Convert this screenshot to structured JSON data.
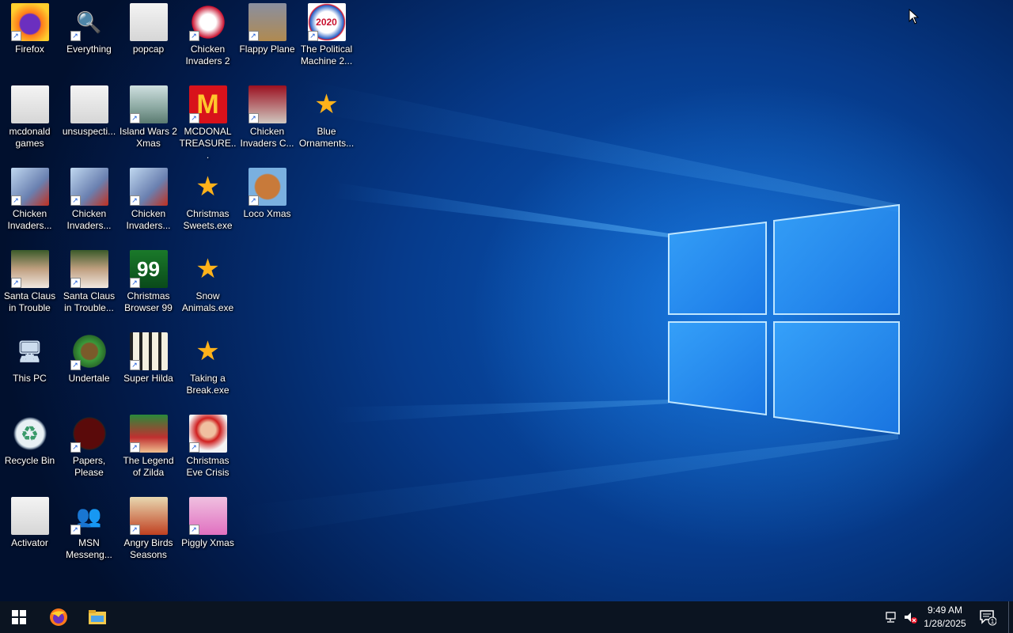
{
  "desktop_icons": [
    {
      "label": "Firefox",
      "icon": "firefox-icon",
      "shortcut": true
    },
    {
      "label": "Everything",
      "icon": "everything-search-icon",
      "shortcut": true
    },
    {
      "label": "popcap",
      "icon": "folder-icon",
      "shortcut": false
    },
    {
      "label": "Chicken Invaders 2",
      "icon": "chicken-invaders-2-icon",
      "shortcut": true
    },
    {
      "label": "Flappy Plane",
      "icon": "flappy-plane-icon",
      "shortcut": true
    },
    {
      "label": "The Political Machine 2...",
      "icon": "political-machine-2020-icon",
      "shortcut": true
    },
    {
      "label": "mcdonald games",
      "icon": "folder-icon",
      "shortcut": false
    },
    {
      "label": "unsuspecti...",
      "icon": "folder-icon",
      "shortcut": false
    },
    {
      "label": "Island Wars 2 Xmas",
      "icon": "island-wars-icon",
      "shortcut": true
    },
    {
      "label": "MCDONAL TREASURE...",
      "icon": "mcdonalds-icon",
      "shortcut": true
    },
    {
      "label": "Chicken Invaders C...",
      "icon": "chicken-invaders-christmas-icon",
      "shortcut": true
    },
    {
      "label": "Blue Ornaments...",
      "icon": "exe-sweets-icon",
      "shortcut": false
    },
    {
      "label": "Chicken Invaders...",
      "icon": "chicken-invaders-icon",
      "shortcut": true
    },
    {
      "label": "Chicken Invaders...",
      "icon": "chicken-invaders-icon",
      "shortcut": true
    },
    {
      "label": "Chicken Invaders...",
      "icon": "chicken-invaders-icon",
      "shortcut": true
    },
    {
      "label": "Christmas Sweets.exe",
      "icon": "exe-sweets-icon",
      "shortcut": false
    },
    {
      "label": "Loco Xmas",
      "icon": "loco-xmas-bear-icon",
      "shortcut": true
    },
    {
      "label": "Santa Claus in Trouble",
      "icon": "santa-claus-icon",
      "shortcut": true
    },
    {
      "label": "Santa Claus in Trouble...",
      "icon": "santa-claus-icon",
      "shortcut": true
    },
    {
      "label": "Christmas Browser 99",
      "icon": "christmas-tree-99-icon",
      "shortcut": true
    },
    {
      "label": "Snow Animals.exe",
      "icon": "exe-sweets-icon",
      "shortcut": false
    },
    {
      "label": "This PC",
      "icon": "computer-icon",
      "shortcut": false
    },
    {
      "label": "Undertale",
      "icon": "undertale-icon",
      "shortcut": true
    },
    {
      "label": "Super Hilda",
      "icon": "super-hilda-icon",
      "shortcut": true
    },
    {
      "label": "Taking a Break.exe",
      "icon": "exe-sweets-icon",
      "shortcut": false
    },
    {
      "label": "Recycle Bin",
      "icon": "recycle-bin-icon",
      "shortcut": false
    },
    {
      "label": "Papers, Please",
      "icon": "papers-please-icon",
      "shortcut": true
    },
    {
      "label": "The Legend of Zilda",
      "icon": "legend-of-zilda-icon",
      "shortcut": true
    },
    {
      "label": "Christmas Eve Crisis",
      "icon": "santa-face-icon",
      "shortcut": true
    },
    {
      "label": "Activator",
      "icon": "folder-icon",
      "shortcut": false
    },
    {
      "label": "MSN Messeng...",
      "icon": "msn-messenger-icon",
      "shortcut": true
    },
    {
      "label": "Angry Birds Seasons",
      "icon": "angry-birds-seasons-icon",
      "shortcut": true
    },
    {
      "label": "Piggly Xmas",
      "icon": "piggly-xmas-icon",
      "shortcut": true
    }
  ],
  "taskbar": {
    "start": "windows-start-icon",
    "pinned": [
      "firefox-icon",
      "file-explorer-icon"
    ],
    "tray": {
      "network": "network-icon",
      "volume": "volume-muted-icon",
      "time": "9:49 AM",
      "date": "1/28/2025",
      "notification_count": "1"
    }
  },
  "colors": {
    "wallpaper_dark": "#021c4e",
    "wallpaper_light": "#1e8fff",
    "taskbar": "#0b1421"
  }
}
